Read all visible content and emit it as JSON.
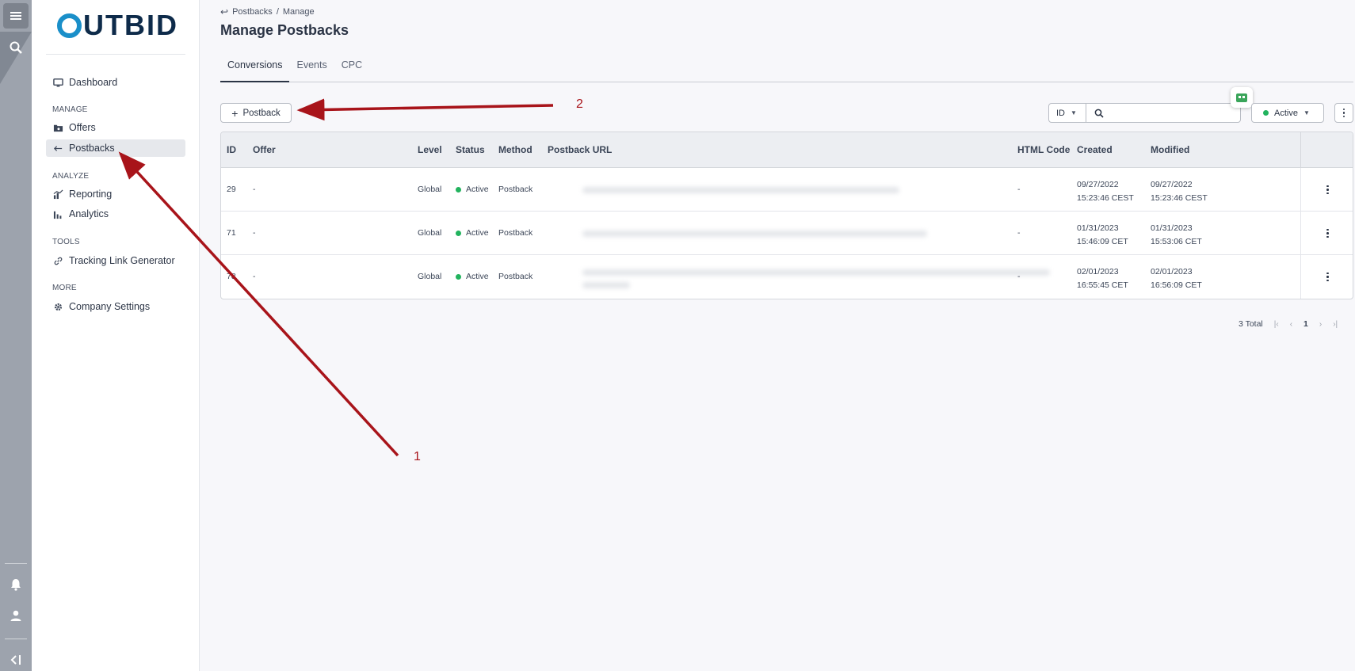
{
  "brand": {
    "logo_text": "UTBID",
    "logo_color": "#1a8fc9"
  },
  "rail": {
    "icons": [
      "menu-icon",
      "search-icon",
      "bell-icon",
      "user-icon",
      "collapse-icon"
    ]
  },
  "sidebar": {
    "dashboard": "Dashboard",
    "sections": {
      "manage": "MANAGE",
      "analyze": "ANALYZE",
      "tools": "TOOLS",
      "more": "MORE"
    },
    "items": {
      "offers": "Offers",
      "postbacks": "Postbacks",
      "reporting": "Reporting",
      "analytics": "Analytics",
      "tracking_link_generator": "Tracking Link Generator",
      "company_settings": "Company Settings"
    }
  },
  "breadcrumb": {
    "parent": "Postbacks",
    "separator": "/",
    "current": "Manage"
  },
  "page_title": "Manage Postbacks",
  "tabs": [
    "Conversions",
    "Events",
    "CPC"
  ],
  "toolbar": {
    "add_label": "Postback",
    "filter_field": "ID",
    "search_value": "",
    "search_placeholder": "",
    "status_filter": "Active",
    "status_color": "#22b35e"
  },
  "table": {
    "columns": [
      "ID",
      "Offer",
      "Level",
      "Status",
      "Method",
      "Postback URL",
      "HTML Code",
      "Created",
      "Modified"
    ],
    "rows": [
      {
        "id": "29",
        "offer": "-",
        "level": "Global",
        "status": "Active",
        "method": "Postback",
        "html": "-",
        "created_date": "09/27/2022",
        "created_time": "15:23:46 CEST",
        "modified_date": "09/27/2022",
        "modified_time": "15:23:46 CEST"
      },
      {
        "id": "71",
        "offer": "-",
        "level": "Global",
        "status": "Active",
        "method": "Postback",
        "html": "-",
        "created_date": "01/31/2023",
        "created_time": "15:46:09 CET",
        "modified_date": "01/31/2023",
        "modified_time": "15:53:06 CET"
      },
      {
        "id": "78",
        "offer": "-",
        "level": "Global",
        "status": "Active",
        "method": "Postback",
        "html": "-",
        "created_date": "02/01/2023",
        "created_time": "16:55:45 CET",
        "modified_date": "02/01/2023",
        "modified_time": "16:56:09 CET"
      }
    ]
  },
  "pagination": {
    "total": "3 Total",
    "page": "1",
    "first": "|‹",
    "prev": "‹",
    "next": "›",
    "last": "›|"
  },
  "annotations": {
    "label_1": "1",
    "label_2": "2",
    "color": "#a8141a"
  }
}
